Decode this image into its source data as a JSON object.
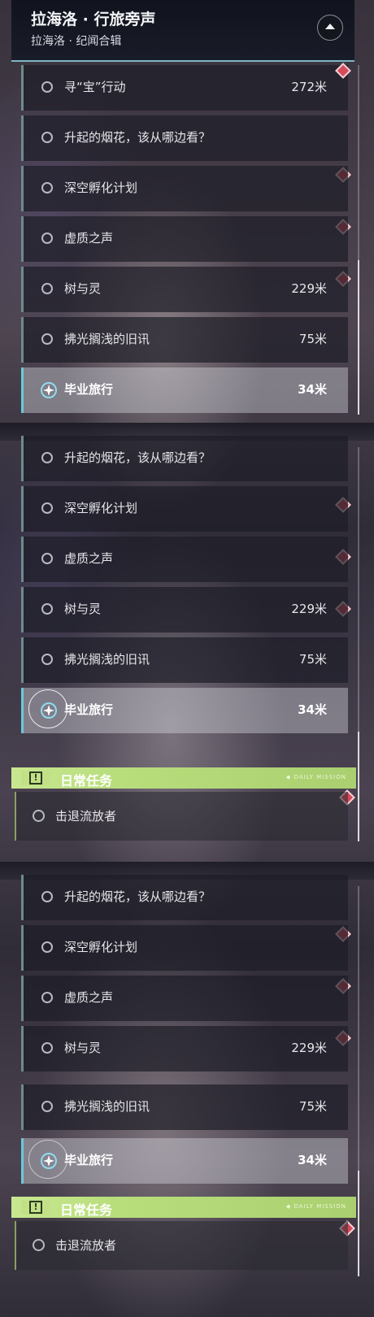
{
  "header": {
    "title": "拉海洛 · 行旅旁声",
    "subtitle": "拉海洛 · 纪闻合辑"
  },
  "section1": [
    {
      "label": "寻“宝”行动",
      "distance": "272米"
    },
    {
      "label": "升起的烟花，该从哪边看？",
      "distance": ""
    },
    {
      "label": "深空孵化计划",
      "distance": ""
    },
    {
      "label": "虚质之声",
      "distance": ""
    },
    {
      "label": "树与灵",
      "distance": "229米"
    },
    {
      "label": "拂光搁浅的旧讯",
      "distance": "75米"
    },
    {
      "label": "毕业旅行",
      "distance": "34米",
      "active": true
    }
  ],
  "section2": [
    {
      "label": "升起的烟花，该从哪边看？",
      "distance": ""
    },
    {
      "label": "深空孵化计划",
      "distance": ""
    },
    {
      "label": "虚质之声",
      "distance": ""
    },
    {
      "label": "树与灵",
      "distance": "229米"
    },
    {
      "label": "拂光搁浅的旧讯",
      "distance": "75米"
    },
    {
      "label": "毕业旅行",
      "distance": "34米",
      "active": true
    }
  ],
  "section3": [
    {
      "label": "升起的烟花，该从哪边看？",
      "distance": ""
    },
    {
      "label": "深空孵化计划",
      "distance": ""
    },
    {
      "label": "虚质之声",
      "distance": ""
    },
    {
      "label": "树与灵",
      "distance": "229米"
    },
    {
      "label": "拂光搁浅的旧讯",
      "distance": "75米"
    },
    {
      "label": "毕业旅行",
      "distance": "34米",
      "active": true
    }
  ],
  "daily": {
    "title": "日常任务",
    "tag": "◆ DAILY MISSION",
    "item": "击退流放者"
  },
  "icons": {
    "header_button": "collapse-up-icon",
    "quest_marker": "red-diamond-marker-icon",
    "tracking": "compass-star-icon",
    "daily": "alert-box-icon"
  },
  "colors": {
    "accent_teal": "#6ec6dc",
    "daily_green": "#b8de7c",
    "marker_red": "#d64a5a"
  }
}
